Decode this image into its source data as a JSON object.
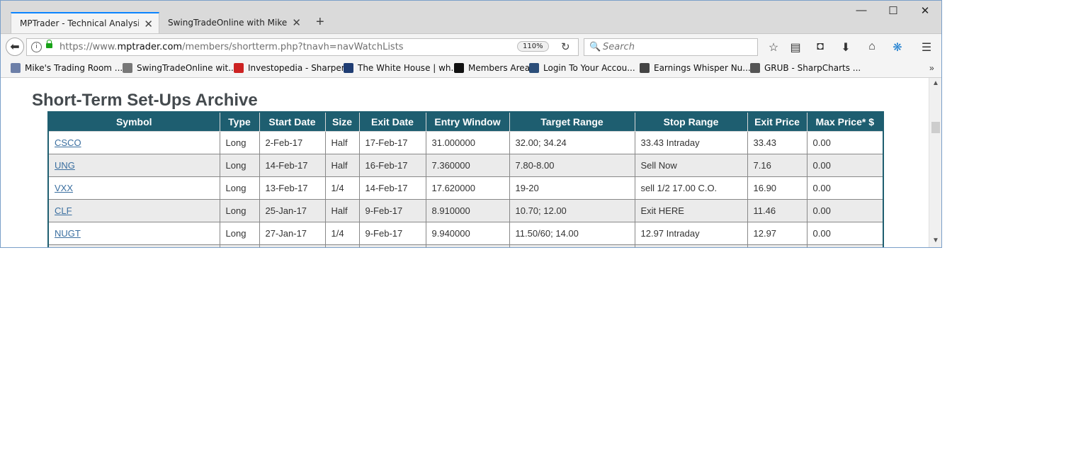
{
  "tabs": [
    {
      "label": "MPTrader - Technical Analysis..."
    },
    {
      "label": "SwingTradeOnline with Mike ..."
    }
  ],
  "window_controls": {
    "minimize": "—",
    "maximize": "☐",
    "close": "✕"
  },
  "address_bar": {
    "url_prefix": "https://www.",
    "url_host": "mptrader.com",
    "url_path": "/members/shortterm.php?tnavh=navWatchLists",
    "zoom": "110%"
  },
  "search": {
    "placeholder": "Search"
  },
  "bookmarks": [
    {
      "label": "Mike's Trading Room ...",
      "color": "#6d7fa8"
    },
    {
      "label": "SwingTradeOnline wit...",
      "color": "#777777"
    },
    {
      "label": "Investopedia - Sharper...",
      "color": "#cc2222"
    },
    {
      "label": "The White House | wh...",
      "color": "#1f3d73"
    },
    {
      "label": "Members Area",
      "color": "#111111"
    },
    {
      "label": "Login To Your Accou...",
      "color": "#2c4f7a"
    },
    {
      "label": "Earnings Whisper Nu...",
      "color": "#444444"
    },
    {
      "label": "GRUB - SharpCharts ...",
      "color": "#555555"
    }
  ],
  "page": {
    "title": "Short-Term Set-Ups Archive",
    "table": {
      "headers": [
        "Symbol",
        "Type",
        "Start Date",
        "Size",
        "Exit Date",
        "Entry Window",
        "Target Range",
        "Stop Range",
        "Exit Price",
        "Max Price* $"
      ],
      "rows": [
        [
          "CSCO",
          "Long",
          "2-Feb-17",
          "Half",
          "17-Feb-17",
          "31.000000",
          "32.00; 34.24",
          "33.43 Intraday",
          "33.43",
          "0.00"
        ],
        [
          "UNG",
          "Long",
          "14-Feb-17",
          "Half",
          "16-Feb-17",
          "7.360000",
          "7.80-8.00",
          "Sell Now",
          "7.16",
          "0.00"
        ],
        [
          "VXX",
          "Long",
          "13-Feb-17",
          "1/4",
          "14-Feb-17",
          "17.620000",
          "19-20",
          "sell 1/2 17.00 C.O.",
          "16.90",
          "0.00"
        ],
        [
          "CLF",
          "Long",
          "25-Jan-17",
          "Half",
          "9-Feb-17",
          "8.910000",
          "10.70; 12.00",
          "Exit HERE",
          "11.46",
          "0.00"
        ],
        [
          "NUGT",
          "Long",
          "27-Jan-17",
          "1/4",
          "9-Feb-17",
          "9.940000",
          "11.50/60; 14.00",
          "12.97 Intraday",
          "12.97",
          "0.00"
        ],
        [
          "",
          "",
          "",
          "",
          "",
          "",
          "",
          "",
          "",
          ""
        ]
      ]
    }
  },
  "colors": {
    "table_header": "#1e5e70",
    "link": "#3b6fa0",
    "tab_accent": "#0a84ff"
  }
}
